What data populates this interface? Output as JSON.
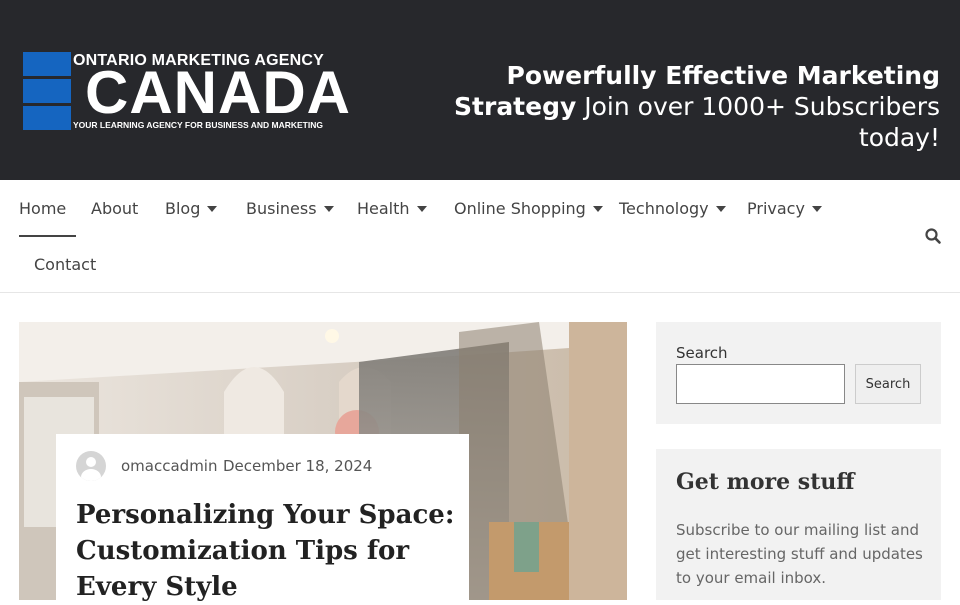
{
  "header": {
    "logo": {
      "top_text": "ONTARIO MARKETING AGENCY",
      "main_text": "CANADA",
      "sub_text": "YOUR LEARNING AGENCY FOR BUSINESS AND MARKETING"
    },
    "tagline_bold": "Powerfully Effective Marketing Strategy",
    "tagline_rest": " Join over 1000+ Subscribers today!"
  },
  "nav": {
    "items": [
      {
        "label": "Home",
        "has_dropdown": false,
        "active": true
      },
      {
        "label": "About",
        "has_dropdown": false
      },
      {
        "label": "Blog",
        "has_dropdown": true
      },
      {
        "label": "Business",
        "has_dropdown": true
      },
      {
        "label": "Health",
        "has_dropdown": true
      },
      {
        "label": "Online Shopping",
        "has_dropdown": true
      },
      {
        "label": "Technology",
        "has_dropdown": true
      },
      {
        "label": "Privacy",
        "has_dropdown": true
      },
      {
        "label": "Contact",
        "has_dropdown": false
      }
    ],
    "search_icon": "search-icon"
  },
  "post": {
    "author": "omaccadmin",
    "date": "December 18, 2024",
    "title": "Personalizing Your Space: Customization Tips for Every Style"
  },
  "sidebar": {
    "search": {
      "label": "Search",
      "input_value": "",
      "button_label": "Search"
    },
    "subscribe": {
      "title": "Get more stuff",
      "text": "Subscribe to our mailing list and get interesting stuff and updates to your email inbox."
    }
  },
  "colors": {
    "header_bg": "#27282c",
    "logo_blue": "#1565c0",
    "widget_bg": "#f2f2f2"
  }
}
